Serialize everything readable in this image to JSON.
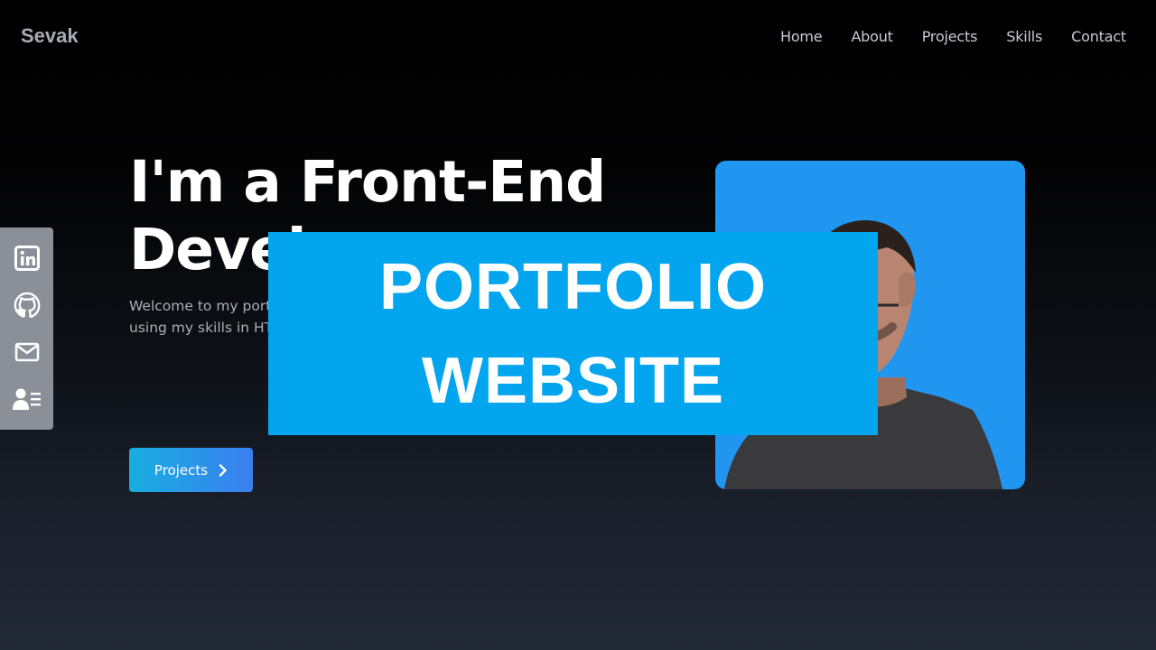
{
  "brand": {
    "name": "Sevak"
  },
  "nav": {
    "items": [
      {
        "label": "Home"
      },
      {
        "label": "About"
      },
      {
        "label": "Projects"
      },
      {
        "label": "Skills"
      },
      {
        "label": "Contact"
      }
    ]
  },
  "social": {
    "items": [
      {
        "icon": "linkedin-icon"
      },
      {
        "icon": "github-icon"
      },
      {
        "icon": "mail-icon"
      },
      {
        "icon": "resume-icon"
      }
    ]
  },
  "hero": {
    "title": "I'm a Front-End Devel",
    "text": "Welcome to my port developer with a pas stunning websites. I s using my skills in HTM engaging user experi beautiful.",
    "cta_label": "Projects",
    "cta_icon": "chevron-right-icon"
  },
  "banner": {
    "line1": "PORTFOLIO",
    "line2": "WEBSITE"
  },
  "colors": {
    "accent": "#03a5ef",
    "photo_bg": "#2196f0",
    "cta_start": "#17aee0",
    "cta_end": "#3c7ff0"
  }
}
